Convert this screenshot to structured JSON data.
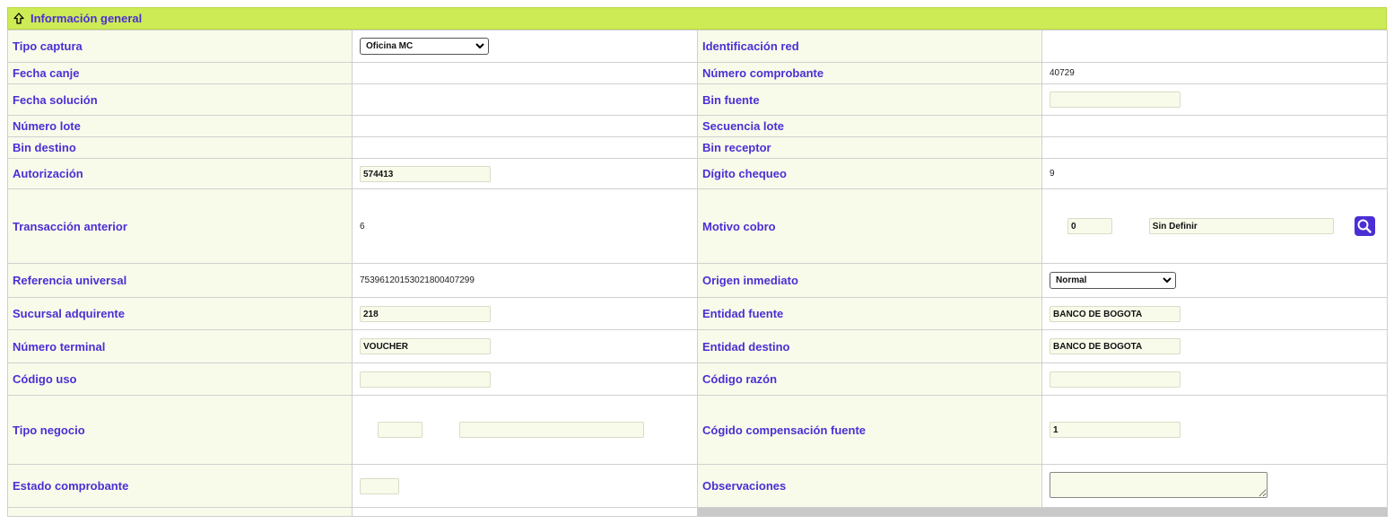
{
  "section": {
    "title": "Información general",
    "icon": "arrow-up-outline-icon",
    "header_color": "#cdeb55"
  },
  "fields": {
    "tipo_captura": {
      "label": "Tipo captura",
      "value": "Oficina MC"
    },
    "identificacion_red": {
      "label": "Identificación red",
      "value": ""
    },
    "fecha_canje": {
      "label": "Fecha canje",
      "value": ""
    },
    "numero_comprobante": {
      "label": "Número comprobante",
      "value": "40729"
    },
    "fecha_solucion": {
      "label": "Fecha solución",
      "value": ""
    },
    "bin_fuente": {
      "label": "Bin fuente",
      "value": ""
    },
    "numero_lote": {
      "label": "Número lote",
      "value": ""
    },
    "secuencia_lote": {
      "label": "Secuencia lote",
      "value": ""
    },
    "bin_destino": {
      "label": "Bin destino",
      "value": ""
    },
    "bin_receptor": {
      "label": "Bin receptor",
      "value": ""
    },
    "autorizacion": {
      "label": "Autorización",
      "value": "574413"
    },
    "digito_chequeo": {
      "label": "Dígito chequeo",
      "value": "9"
    },
    "transaccion_anterior": {
      "label": "Transacción anterior",
      "value": "6"
    },
    "motivo_cobro": {
      "label": "Motivo cobro",
      "code": "0",
      "description": "Sin Definir"
    },
    "referencia_universal": {
      "label": "Referencia universal",
      "value": "75396120153021800407299"
    },
    "origen_inmediato": {
      "label": "Origen inmediato",
      "value": "Normal"
    },
    "sucursal_adquirente": {
      "label": "Sucursal adquirente",
      "value": "218"
    },
    "entidad_fuente": {
      "label": "Entidad fuente",
      "value": "BANCO DE BOGOTA"
    },
    "numero_terminal": {
      "label": "Número terminal",
      "value": "VOUCHER"
    },
    "entidad_destino": {
      "label": "Entidad destino",
      "value": "BANCO DE BOGOTA"
    },
    "codigo_uso": {
      "label": "Código uso",
      "value": ""
    },
    "codigo_razon": {
      "label": "Código razón",
      "value": ""
    },
    "tipo_negocio": {
      "label": "Tipo negocio",
      "code": "",
      "description": ""
    },
    "codigo_compensacion_fuente": {
      "label": "Cógido compensación fuente",
      "value": "1"
    },
    "estado_comprobante": {
      "label": "Estado comprobante",
      "value": ""
    },
    "observaciones": {
      "label": "Observaciones",
      "value": ""
    }
  },
  "colors": {
    "label_text": "#4b2fd4",
    "label_bg": "#f9fbea",
    "button_bg": "#4b2fd4"
  }
}
